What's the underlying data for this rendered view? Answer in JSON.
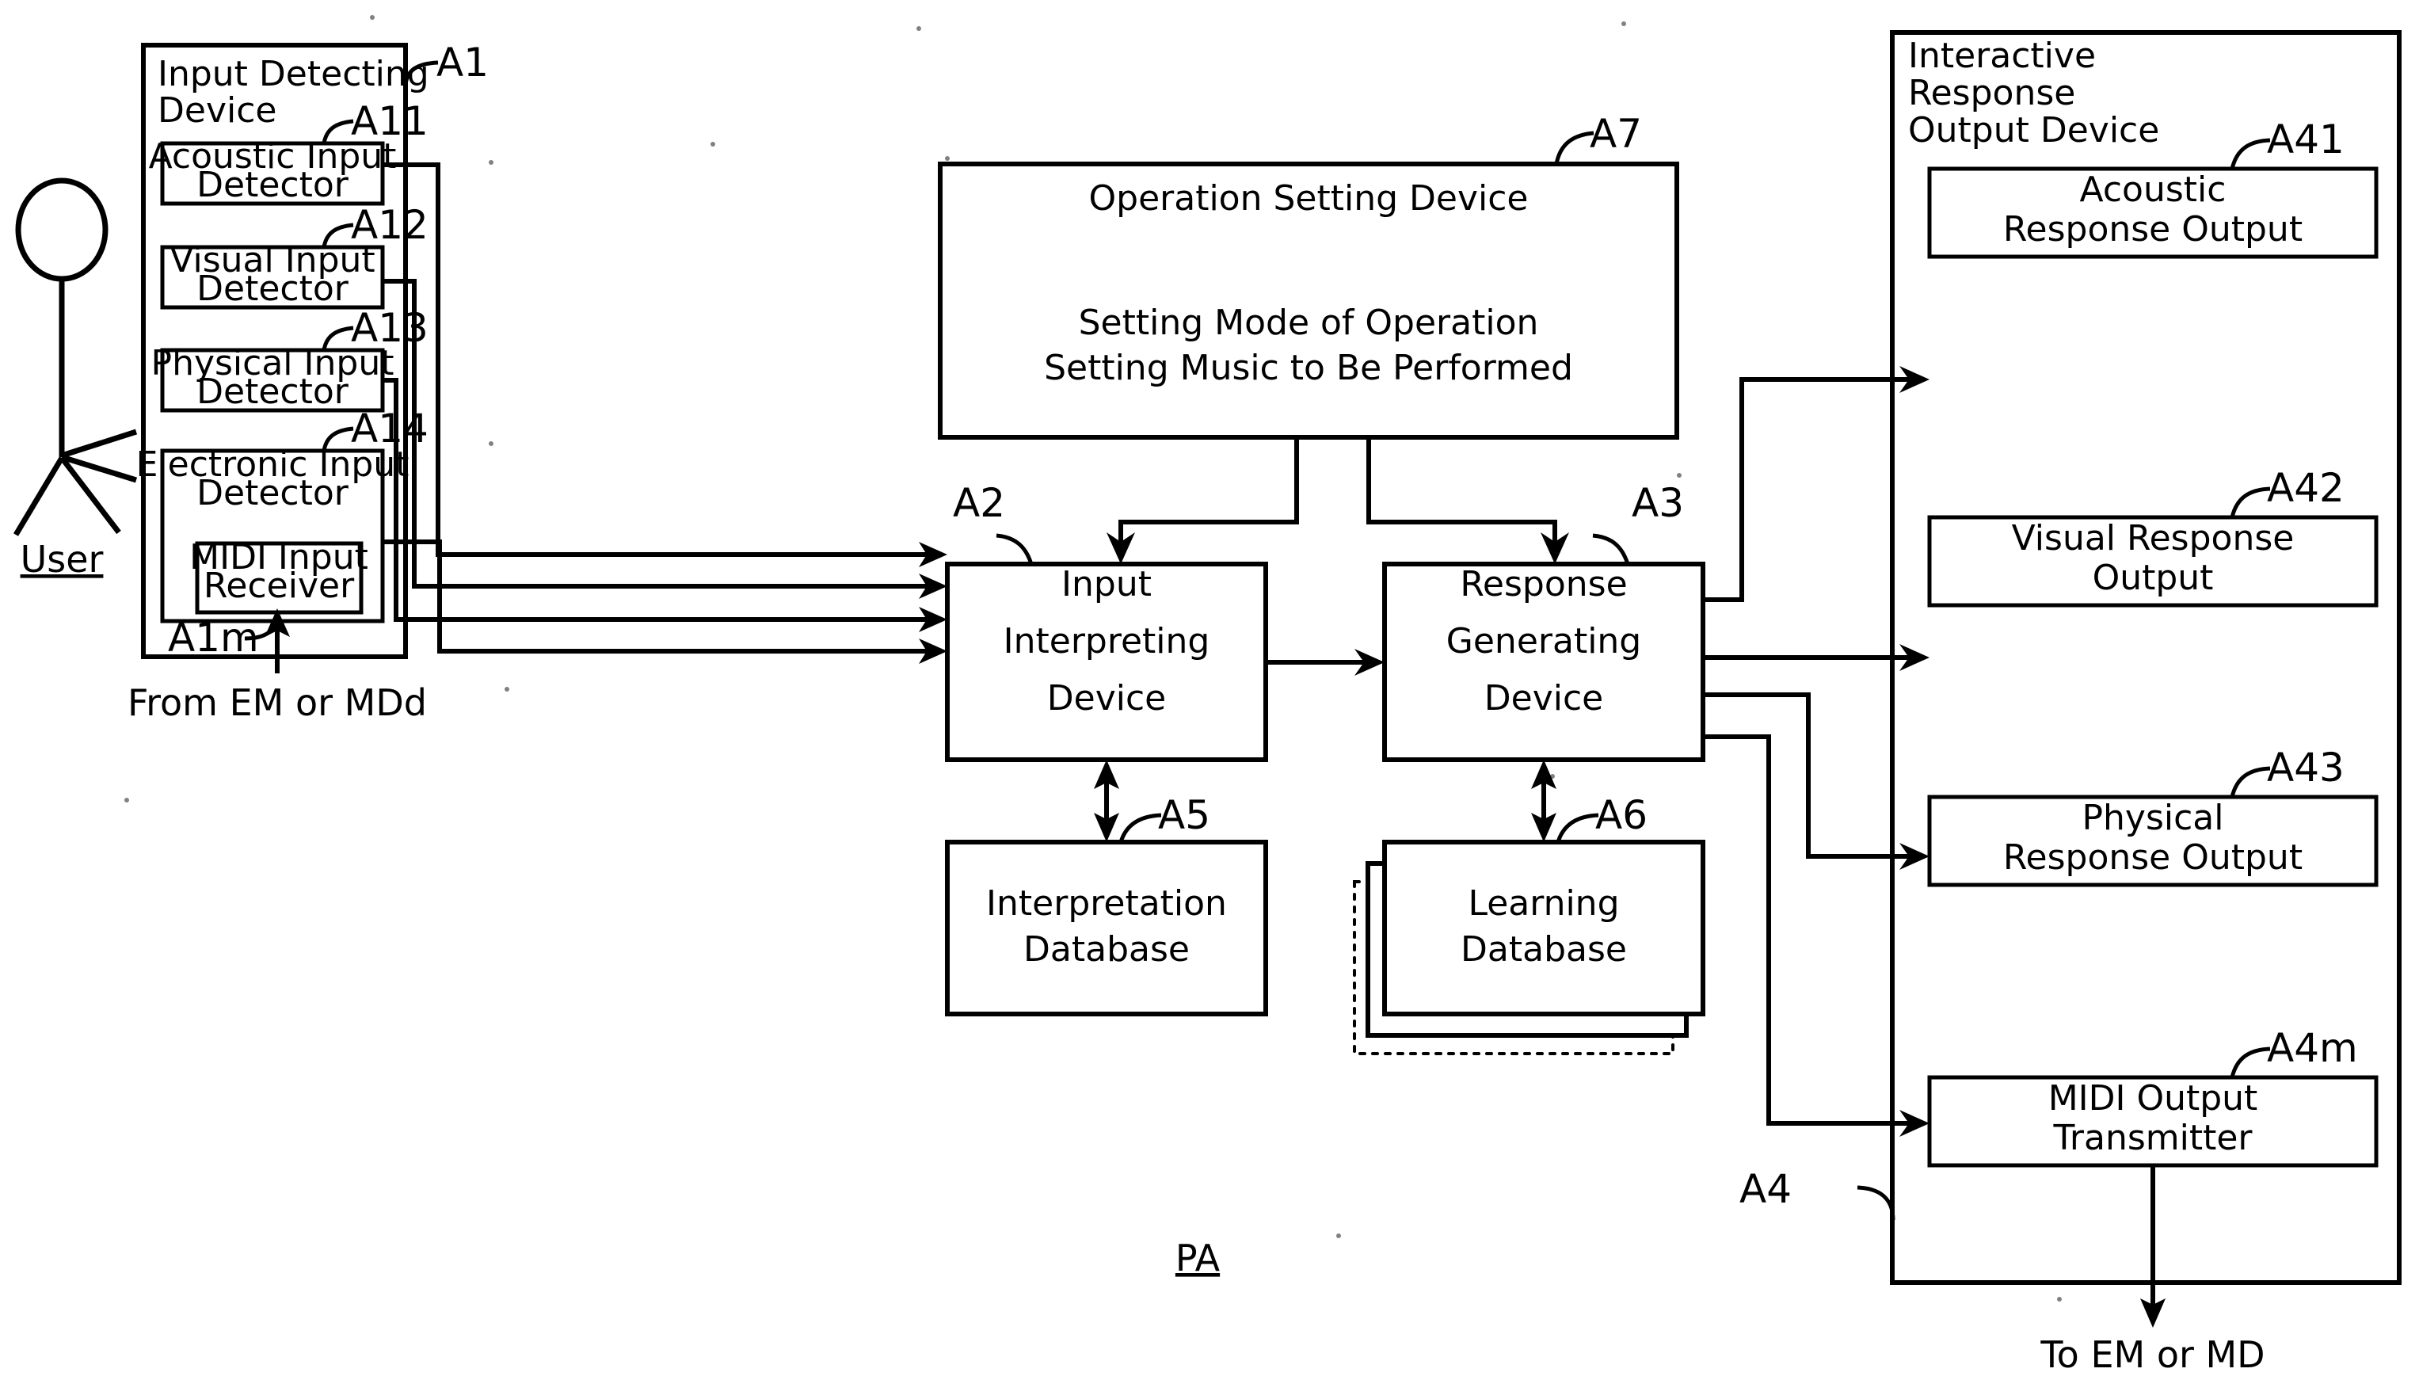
{
  "diagram": {
    "figure_label": "PA",
    "actor": {
      "label": "User",
      "icon": "stick-figure-person"
    },
    "panels": [
      {
        "id": "A1",
        "ref": "A1",
        "title_lines": [
          "Input Detecting",
          "Device"
        ],
        "children": [
          {
            "ref": "A11",
            "lines": [
              "Acoustic Input",
              "Detector"
            ]
          },
          {
            "ref": "A12",
            "lines": [
              "Visual Input",
              "Detector"
            ]
          },
          {
            "ref": "A13",
            "lines": [
              "Physical Input",
              "Detector"
            ]
          },
          {
            "ref": "A14",
            "lines": [
              "Electronic Input",
              "Detector"
            ],
            "children": [
              {
                "ref": "A1m",
                "lines": [
                  "MIDI Input",
                  "Receiver"
                ]
              }
            ]
          }
        ]
      },
      {
        "id": "A4",
        "ref": "A4",
        "title_lines": [
          "Interactive",
          "Response",
          "Output Device"
        ],
        "children": [
          {
            "ref": "A41",
            "lines": [
              "Acoustic",
              "Response Output"
            ]
          },
          {
            "ref": "A42",
            "lines": [
              "Visual Response",
              "Output"
            ]
          },
          {
            "ref": "A43",
            "lines": [
              "Physical",
              "Response Output"
            ]
          },
          {
            "ref": "A4m",
            "lines": [
              "MIDI Output",
              "Transmitter"
            ]
          }
        ]
      }
    ],
    "blocks": [
      {
        "ref": "A7",
        "lines": [
          "Operation Setting Device",
          "",
          "Setting Mode of Operation",
          "Setting Music to Be Performed"
        ]
      },
      {
        "ref": "A2",
        "lines": [
          "Input",
          "Interpreting",
          "Device"
        ]
      },
      {
        "ref": "A3",
        "lines": [
          "Response",
          "Generating",
          "Device"
        ]
      },
      {
        "ref": "A5",
        "lines": [
          "Interpretation",
          "Database"
        ]
      },
      {
        "ref": "A6",
        "lines": [
          "Learning",
          "Database"
        ],
        "stacked": true
      }
    ],
    "external_notes": {
      "input_source": "From EM or MDd",
      "output_target": "To EM or MD"
    },
    "reference_labels": [
      "A1",
      "A11",
      "A12",
      "A13",
      "A14",
      "A1m",
      "A2",
      "A3",
      "A4",
      "A41",
      "A42",
      "A43",
      "A4m",
      "A5",
      "A6",
      "A7"
    ],
    "colors": {
      "line": "#000000",
      "background": "#ffffff"
    }
  }
}
